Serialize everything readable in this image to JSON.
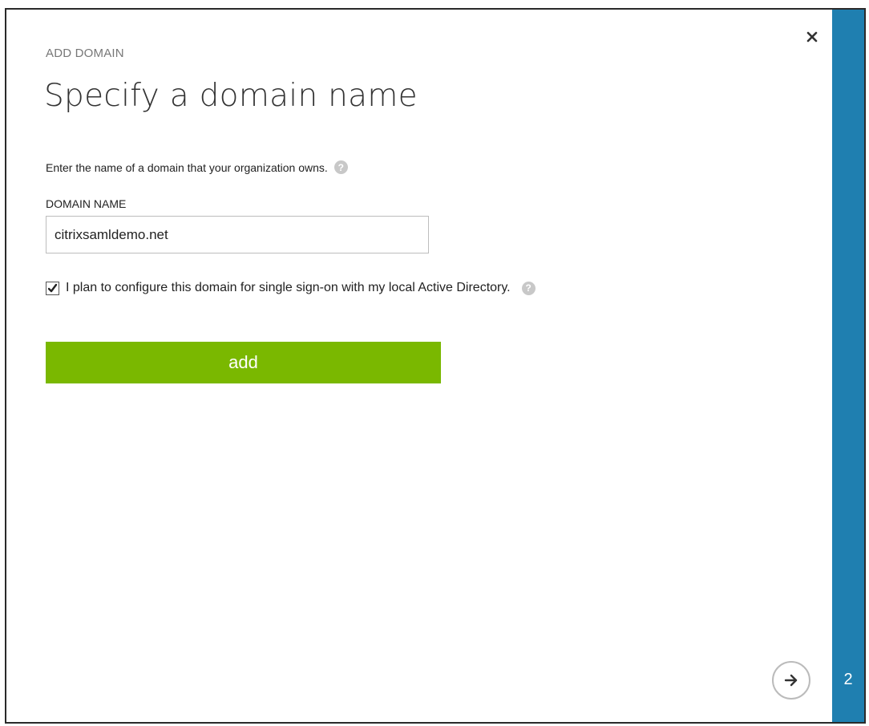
{
  "dialog": {
    "kicker": "ADD DOMAIN",
    "title": "Specify a domain name",
    "instruction": "Enter the name of a domain that your organization owns.",
    "help_glyph": "?",
    "close_glyph": "×"
  },
  "form": {
    "domain_label": "DOMAIN NAME",
    "domain_value": "citrixsamldemo.net",
    "sso_checked": true,
    "sso_label": "I plan to configure this domain for single sign-on with my local Active Directory.",
    "add_label": "add"
  },
  "wizard": {
    "step_number": "2",
    "next_icon": "arrow-right-icon"
  },
  "colors": {
    "accent_blue": "#1f7fb0",
    "button_green": "#7ab800",
    "help_gray": "#c8c8c8"
  }
}
